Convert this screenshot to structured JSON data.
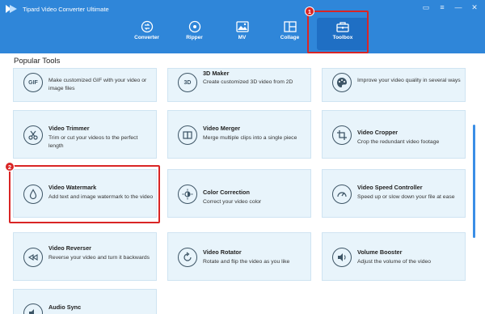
{
  "app": {
    "title": "Tipard Video Converter Ultimate"
  },
  "window_controls": [
    "chat-icon",
    "menu-icon",
    "minimize-icon",
    "close-icon"
  ],
  "tabs": [
    {
      "label": "Converter",
      "icon": "converter-icon"
    },
    {
      "label": "Ripper",
      "icon": "ripper-icon"
    },
    {
      "label": "MV",
      "icon": "mv-icon"
    },
    {
      "label": "Collage",
      "icon": "collage-icon"
    },
    {
      "label": "Toolbox",
      "icon": "toolbox-icon",
      "active": true
    }
  ],
  "callouts": [
    "1",
    "2"
  ],
  "section": {
    "title": "Popular Tools"
  },
  "tools": [
    {
      "title": "",
      "desc": "Make customized GIF with your video or image files",
      "icon": "gif-icon",
      "icon_text": "GIF"
    },
    {
      "title": "3D Maker",
      "desc": "Create customized 3D video from 2D",
      "icon": "3d-icon",
      "icon_text": "3D"
    },
    {
      "title": "",
      "desc": "Improve your video quality in several ways",
      "icon": "palette-icon"
    },
    {
      "title": "Video Trimmer",
      "desc": "Trim or cut your videos to the perfect length",
      "icon": "scissors-icon"
    },
    {
      "title": "Video Merger",
      "desc": "Merge multiple clips into a single piece",
      "icon": "merge-icon"
    },
    {
      "title": "Video Cropper",
      "desc": "Crop the redundant video footage",
      "icon": "crop-icon"
    },
    {
      "title": "Video Watermark",
      "desc": "Add text and image watermark to the video",
      "icon": "droplet-icon"
    },
    {
      "title": "Color Correction",
      "desc": "Correct your video color",
      "icon": "sun-icon"
    },
    {
      "title": "Video Speed Controller",
      "desc": "Speed up or slow down your file at ease",
      "icon": "speedometer-icon"
    },
    {
      "title": "Video Reverser",
      "desc": "Reverse your video and turn it backwards",
      "icon": "rewind-icon"
    },
    {
      "title": "Video Rotator",
      "desc": "Rotate and flip the video as you like",
      "icon": "rotate-icon"
    },
    {
      "title": "Volume Booster",
      "desc": "Adjust the volume of the video",
      "icon": "volume-icon"
    },
    {
      "title": "Audio Sync",
      "desc": "",
      "icon": "audio-sync-icon"
    }
  ],
  "colors": {
    "header": "#2f86d9",
    "active_tab": "#1f6fc4",
    "card_bg": "#e8f4fb",
    "callout": "#d92525"
  }
}
